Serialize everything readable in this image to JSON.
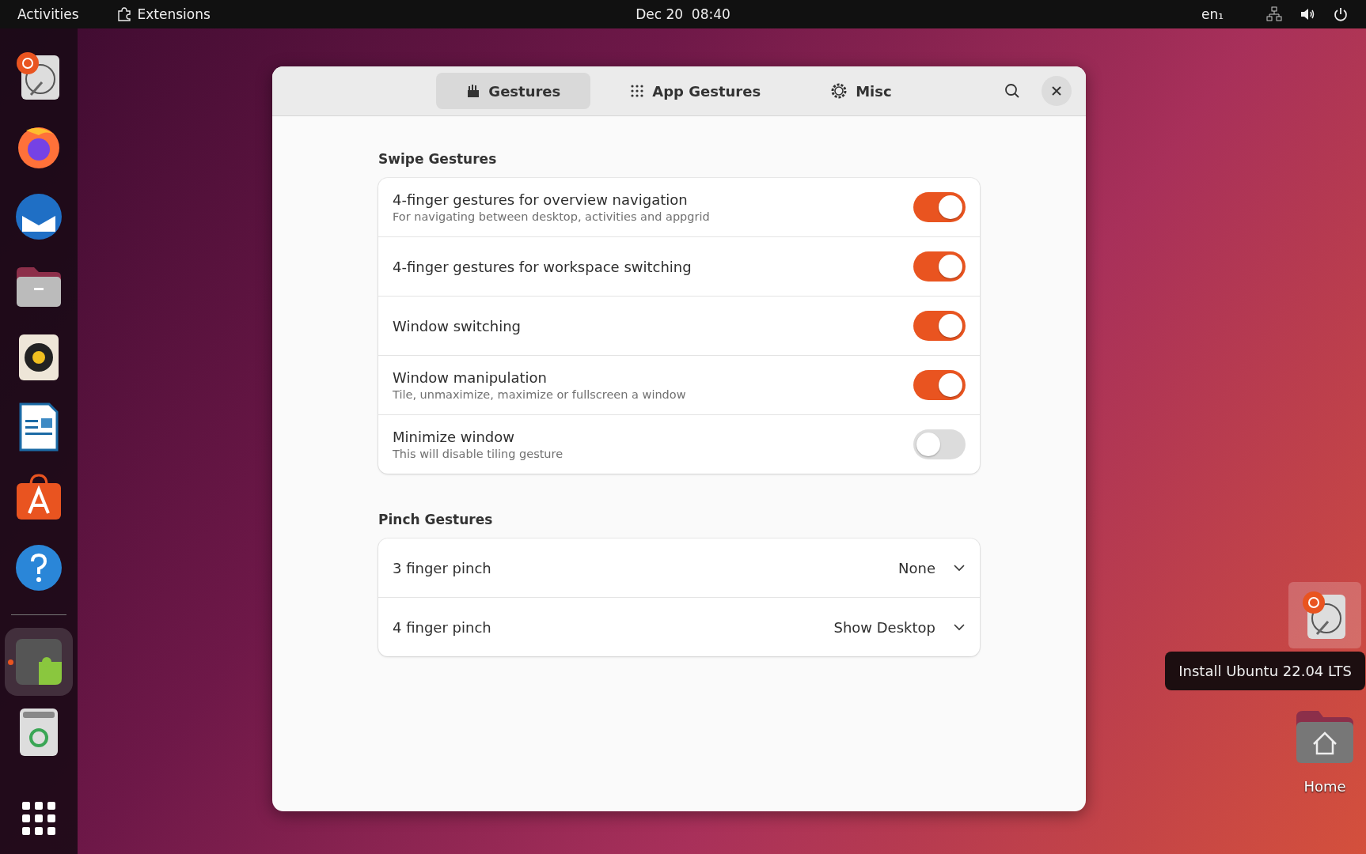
{
  "top_bar": {
    "activities": "Activities",
    "extensions": "Extensions",
    "clock": "Dec 20  08:40",
    "keyboard_layout": "en₁"
  },
  "dock": {
    "apps": [
      {
        "kind": "installer",
        "running": false
      },
      {
        "kind": "browser",
        "running": false
      },
      {
        "kind": "mail",
        "running": false
      },
      {
        "kind": "files",
        "running": false
      },
      {
        "kind": "music",
        "running": false
      },
      {
        "kind": "writer",
        "running": false
      },
      {
        "kind": "store",
        "running": false
      },
      {
        "kind": "help",
        "running": false
      },
      {
        "kind": "extensions",
        "running": true
      },
      {
        "kind": "trash",
        "running": false
      }
    ]
  },
  "window": {
    "tabs": [
      {
        "label": "Gestures",
        "selected": true
      },
      {
        "label": "App Gestures",
        "selected": false
      },
      {
        "label": "Misc",
        "selected": false
      }
    ],
    "sections": [
      {
        "title": "Swipe Gestures",
        "rows": [
          {
            "kind": "switch",
            "title": "4-finger gestures for overview navigation",
            "subtitle": "For navigating between desktop, activities and appgrid",
            "on": true
          },
          {
            "kind": "switch",
            "title": "4-finger gestures for workspace switching",
            "on": true
          },
          {
            "kind": "switch",
            "title": "Window switching",
            "on": true
          },
          {
            "kind": "switch",
            "title": "Window manipulation",
            "subtitle": "Tile, unmaximize, maximize or fullscreen a window",
            "on": true
          },
          {
            "kind": "switch",
            "title": "Minimize window",
            "subtitle": "This will disable tiling gesture",
            "on": false
          }
        ]
      },
      {
        "title": "Pinch Gestures",
        "rows": [
          {
            "kind": "dropdown",
            "title": "3 finger pinch",
            "value": "None"
          },
          {
            "kind": "dropdown",
            "title": "4 finger pinch",
            "value": "Show Desktop"
          }
        ]
      }
    ]
  },
  "desktop": {
    "tooltip": "Install Ubuntu 22.04 LTS",
    "icons": [
      {
        "kind": "installer"
      },
      {
        "kind": "home",
        "label": "Home"
      }
    ]
  }
}
